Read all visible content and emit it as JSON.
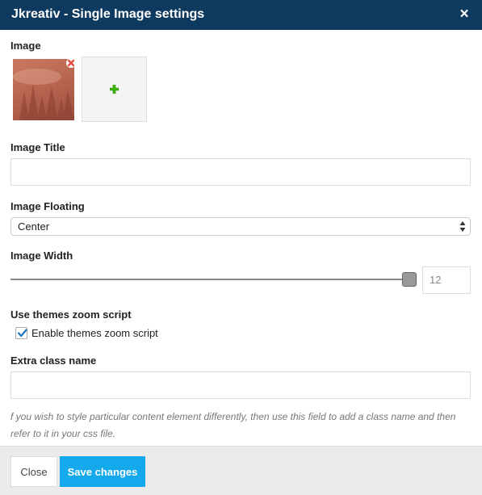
{
  "dialog": {
    "title": "Jkreativ - Single Image settings",
    "close_glyph": "×"
  },
  "image_section": {
    "label": "Image",
    "remove_icon": "remove-icon",
    "add_icon": "plus-icon"
  },
  "title_field": {
    "label": "Image Title",
    "value": ""
  },
  "floating": {
    "label": "Image Floating",
    "selected": "Center"
  },
  "width": {
    "label": "Image Width",
    "value": "12"
  },
  "zoom": {
    "label": "Use themes zoom script",
    "checkbox_label": "Enable themes zoom script",
    "checked": true
  },
  "extra_class": {
    "label": "Extra class name",
    "value": "",
    "help": "f you wish to style particular content element differently, then use this field to add a class name and then refer to it in your css file."
  },
  "footer": {
    "close_label": "Close",
    "save_label": "Save changes"
  },
  "colors": {
    "header_bg": "#0f3a5f",
    "primary": "#13a9ec",
    "remove": "#e74c3c",
    "add": "#3cb400"
  }
}
